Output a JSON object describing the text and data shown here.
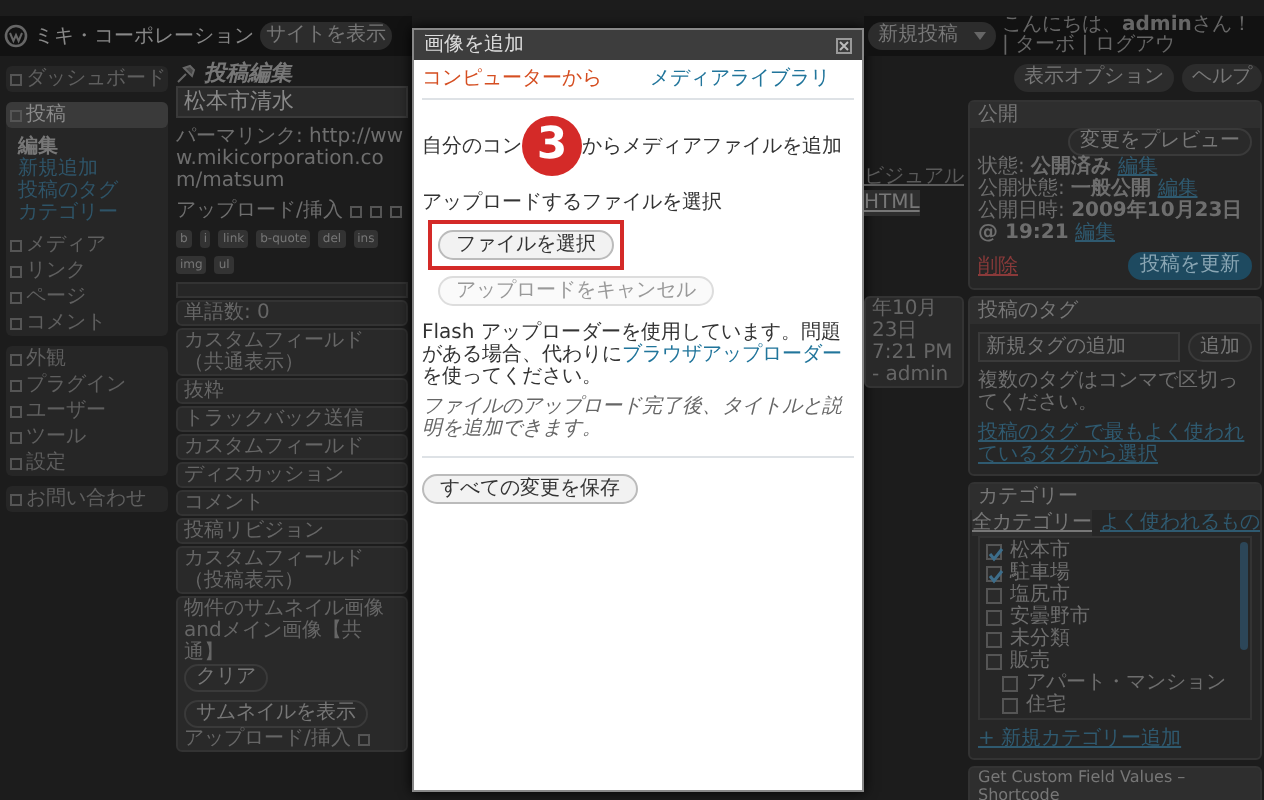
{
  "header": {
    "site_title": "ミキ・コーポレーション",
    "view_site_button": "サイトを表示",
    "new_post_button": "新規投稿",
    "greeting": "こんにちは、**admin**さん！ | ターボ | ログアウ",
    "screen_options_button": "表示オプション",
    "help_button": "ヘルプ"
  },
  "sidebar": {
    "groups": [
      [
        {
          "label": "ダッシュボード",
          "selected": false
        }
      ],
      [
        {
          "label": "投稿",
          "selected": true,
          "children": [
            {
              "label": "編集",
              "selected": true
            },
            {
              "label": "新規追加",
              "selected": false
            },
            {
              "label": "投稿のタグ",
              "selected": false
            },
            {
              "label": "カテゴリー",
              "selected": false
            }
          ]
        },
        {
          "label": "メディア",
          "selected": false
        },
        {
          "label": "リンク",
          "selected": false
        },
        {
          "label": "ページ",
          "selected": false
        },
        {
          "label": "コメント",
          "selected": false
        }
      ],
      [
        {
          "label": "外観",
          "selected": false
        },
        {
          "label": "プラグイン",
          "selected": false
        },
        {
          "label": "ユーザー",
          "selected": false
        },
        {
          "label": "ツール",
          "selected": false
        },
        {
          "label": "設定",
          "selected": false
        }
      ],
      [
        {
          "label": "お問い合わせ",
          "selected": false
        }
      ]
    ]
  },
  "editor": {
    "page_title": "投稿編集",
    "post_title": "松本市清水",
    "permalink": "パーマリンク: http://www.mikicorporation.com/matsum",
    "upload_label": "アップロード/挿入",
    "toolbar": [
      "b",
      "i",
      "link",
      "b-quote",
      "del",
      "ins",
      "img",
      "ul"
    ],
    "tabs": [
      {
        "label": "ビジュアル",
        "selected": false
      },
      {
        "label": "HTML",
        "selected": true
      }
    ],
    "word_count": "単語数: 0",
    "last_edited": "年10月23日 7:21 PM - admin",
    "boxes": [
      "カスタムフィールド（共通表示）",
      "抜粋",
      "トラックバック送信",
      "カスタムフィールド",
      "ディスカッション",
      "コメント",
      "投稿リビジョン",
      "カスタムフィールド（投稿表示）"
    ],
    "thumbnail_box": {
      "title": "物件のサムネイル画像andメイン画像【共通】",
      "buttons": [
        "クリア",
        "サムネイルを表示"
      ],
      "upload_label": "アップロード/挿入"
    }
  },
  "publish": {
    "title": "公開",
    "preview_button": "変更をプレビュー",
    "lines": [
      {
        "text": "状態: **公開済み**",
        "link": "編集"
      },
      {
        "text": "公開状態: **一般公開**",
        "link": "編集"
      },
      {
        "text": "公開日時: **2009年10月23日 @ 19:21**",
        "link": "編集"
      }
    ],
    "delete_link": "削除",
    "update_button": "投稿を更新"
  },
  "tags": {
    "title": "投稿のタグ",
    "placeholder": "新規タグの追加",
    "add_button": "追加",
    "hint": "複数のタグはコンマで区切ってください。",
    "link": "投稿のタグ で最もよく使われているタグから選択"
  },
  "categories": {
    "title": "カテゴリー",
    "tabs": [
      {
        "label": "全カテゴリー",
        "selected": true
      },
      {
        "label": "よく使われるもの",
        "selected": false
      }
    ],
    "items": [
      {
        "label": "松本市",
        "checked": true
      },
      {
        "label": "駐車場",
        "checked": true
      },
      {
        "label": "塩尻市",
        "checked": false
      },
      {
        "label": "安曇野市",
        "checked": false
      },
      {
        "label": "未分類",
        "checked": false
      },
      {
        "label": "販売",
        "checked": false,
        "children": [
          {
            "label": "アパート・マンション",
            "checked": false
          },
          {
            "label": "住宅",
            "checked": false
          }
        ]
      }
    ],
    "add_link": "+ 新規カテゴリー追加"
  },
  "custom_field_box": {
    "title": "Get Custom Field Values – Shortcode"
  },
  "modal": {
    "title": "画像を追加",
    "tabs": [
      {
        "label": "コンピューターから",
        "selected": true
      },
      {
        "label": "メディアライブラリ",
        "selected": false
      }
    ],
    "heading_parts": [
      "自分のコン",
      "からメディアファイルを追加"
    ],
    "step_marker": "3",
    "select_label": "アップロードするファイルを選択",
    "select_button": "ファイルを選択",
    "cancel_button": {
      "label": "アップロードをキャンセル",
      "disabled": true
    },
    "notice": "Flash アップローダーを使用しています。問題がある場合、代わりに",
    "notice_link": "ブラウザアップローダー",
    "notice_end": "を使ってください。",
    "hint": "ファイルのアップロード完了後、タイトルと説明を追加できます。",
    "save_button": "すべての変更を保存"
  }
}
